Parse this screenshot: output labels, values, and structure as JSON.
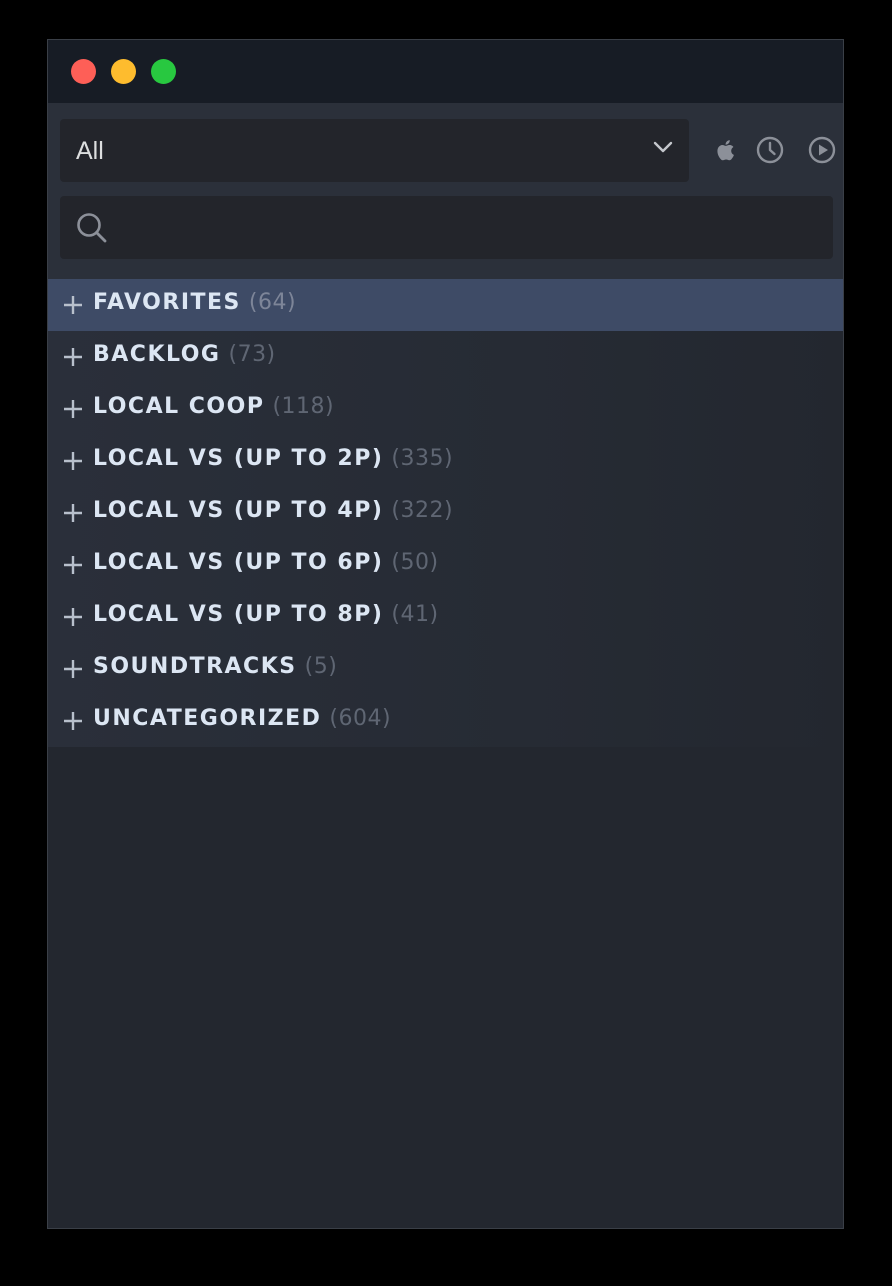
{
  "window": {
    "traffic_lights": {
      "close_color": "#fe5f57",
      "minimize_color": "#febc2e",
      "zoom_color": "#28c840"
    }
  },
  "toolbar": {
    "filter": {
      "selected": "All",
      "icon": "chevron-down-icon"
    },
    "icons": [
      "apple-icon",
      "clock-icon",
      "play-icon"
    ],
    "search": {
      "value": "",
      "placeholder": "",
      "icon": "search-icon"
    }
  },
  "collections": [
    {
      "label": "FAVORITES",
      "count": "(64)",
      "selected": true
    },
    {
      "label": "BACKLOG",
      "count": "(73)",
      "selected": false
    },
    {
      "label": "LOCAL COOP",
      "count": "(118)",
      "selected": false
    },
    {
      "label": "LOCAL VS (UP TO 2P)",
      "count": "(335)",
      "selected": false
    },
    {
      "label": "LOCAL VS (UP TO 4P)",
      "count": "(322)",
      "selected": false
    },
    {
      "label": "LOCAL VS (UP TO 6P)",
      "count": "(50)",
      "selected": false
    },
    {
      "label": "LOCAL VS (UP TO 8P)",
      "count": "(41)",
      "selected": false
    },
    {
      "label": "SOUNDTRACKS",
      "count": "(5)",
      "selected": false
    },
    {
      "label": "UNCATEGORIZED",
      "count": "(604)",
      "selected": false
    }
  ],
  "colors": {
    "background": "#23272f",
    "titlebar": "#171c25",
    "selected_row": "#3e4b66",
    "label_text": "#dce6f3",
    "count_text": "#5f6673"
  }
}
